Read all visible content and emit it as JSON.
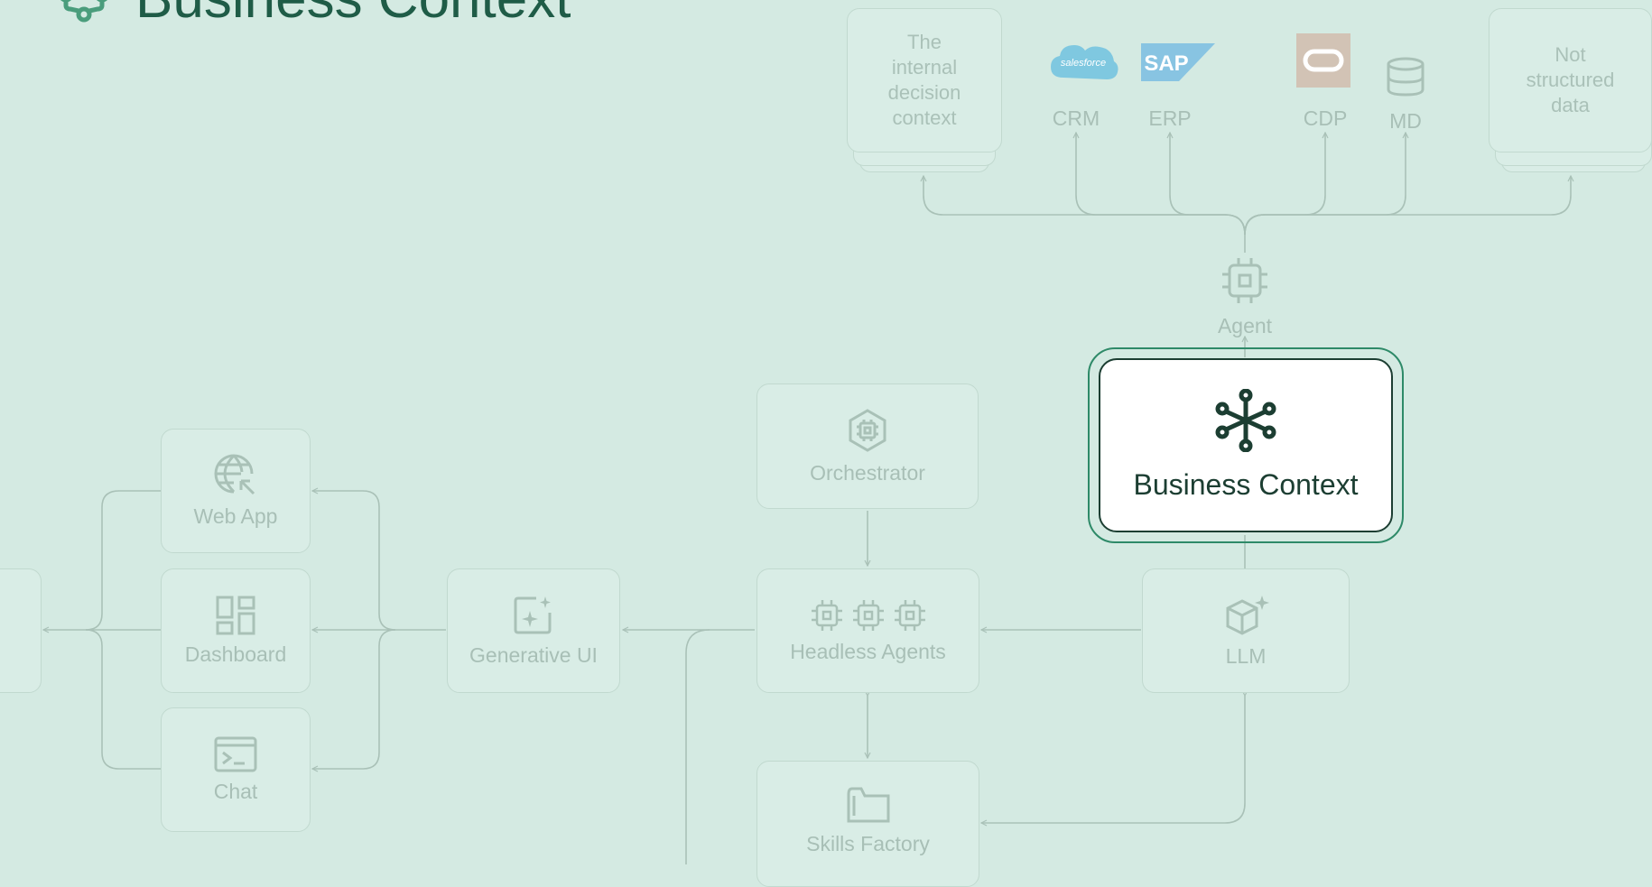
{
  "header": {
    "title": "Business Context"
  },
  "sources": {
    "internal": {
      "lines": [
        "The",
        "internal",
        "decision",
        "context"
      ]
    },
    "unstructured": {
      "lines": [
        "Not",
        "structured",
        "data"
      ]
    },
    "crm": {
      "label": "CRM",
      "logo_text": "salesforce"
    },
    "erp": {
      "label": "ERP",
      "logo_text": "SAP"
    },
    "cdp": {
      "label": "CDP"
    },
    "md": {
      "label": "MD"
    }
  },
  "nodes": {
    "agent": "Agent",
    "business_context": "Business Context",
    "orchestrator": "Orchestrator",
    "headless_agents": "Headless Agents",
    "llm": "LLM",
    "skills_factory": "Skills Factory",
    "generative_ui": "Generative UI",
    "web_app": "Web App",
    "dashboard": "Dashboard",
    "chat": "Chat"
  },
  "colors": {
    "background": "#d4eae2",
    "accent": "#2e8a68",
    "dark": "#1c3e32",
    "muted_text": "#a8bfb6",
    "salesforce": "#7fc8e0",
    "sap": "#88c4e2",
    "oracle": "#d2c3b5"
  }
}
